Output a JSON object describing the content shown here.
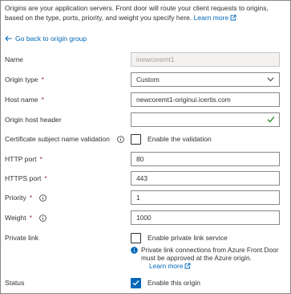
{
  "intro": {
    "text": "Origins are your application servers. Front door will route your client requests to origins, based on the type, ports, priority, and weight you specify here.",
    "learn_more": "Learn more"
  },
  "back_link": "Go back to origin group",
  "fields": {
    "name": {
      "label": "Name",
      "value": "inewcoremt1"
    },
    "origin_type": {
      "label": "Origin type",
      "required": "*",
      "value": "Custom"
    },
    "host_name": {
      "label": "Host name",
      "required": "*",
      "value": "newcoremt1-originui.icertis.com"
    },
    "origin_host_header": {
      "label": "Origin host header",
      "value": ""
    },
    "cert_validation": {
      "label": "Certificate subject name validation",
      "checkbox_label": "Enable the validation",
      "checked": false
    },
    "http_port": {
      "label": "HTTP port",
      "required": "*",
      "value": "80"
    },
    "https_port": {
      "label": "HTTPS port",
      "required": "*",
      "value": "443"
    },
    "priority": {
      "label": "Priority",
      "required": "*",
      "value": "1"
    },
    "weight": {
      "label": "Weight",
      "required": "*",
      "value": "1000"
    },
    "private_link": {
      "label": "Private link",
      "checkbox_label": "Enable private link service",
      "checked": false,
      "info_text": "Private link connections from Azure Front Door must be approved at the Azure origin.",
      "learn_more": "Learn more"
    },
    "status": {
      "label": "Status",
      "checkbox_label": "Enable this origin",
      "checked": true
    }
  },
  "colors": {
    "link": "#0067b8",
    "required": "#a4262c",
    "checkbox_checked": "#0067b8",
    "valid_check": "#107c10",
    "border": "#8a8886"
  },
  "icons": [
    "external-link-icon",
    "back-arrow-icon",
    "info-icon",
    "chevron-down-icon",
    "valid-checkmark-icon",
    "checkbox-checkmark-icon",
    "info-filled-icon"
  ]
}
